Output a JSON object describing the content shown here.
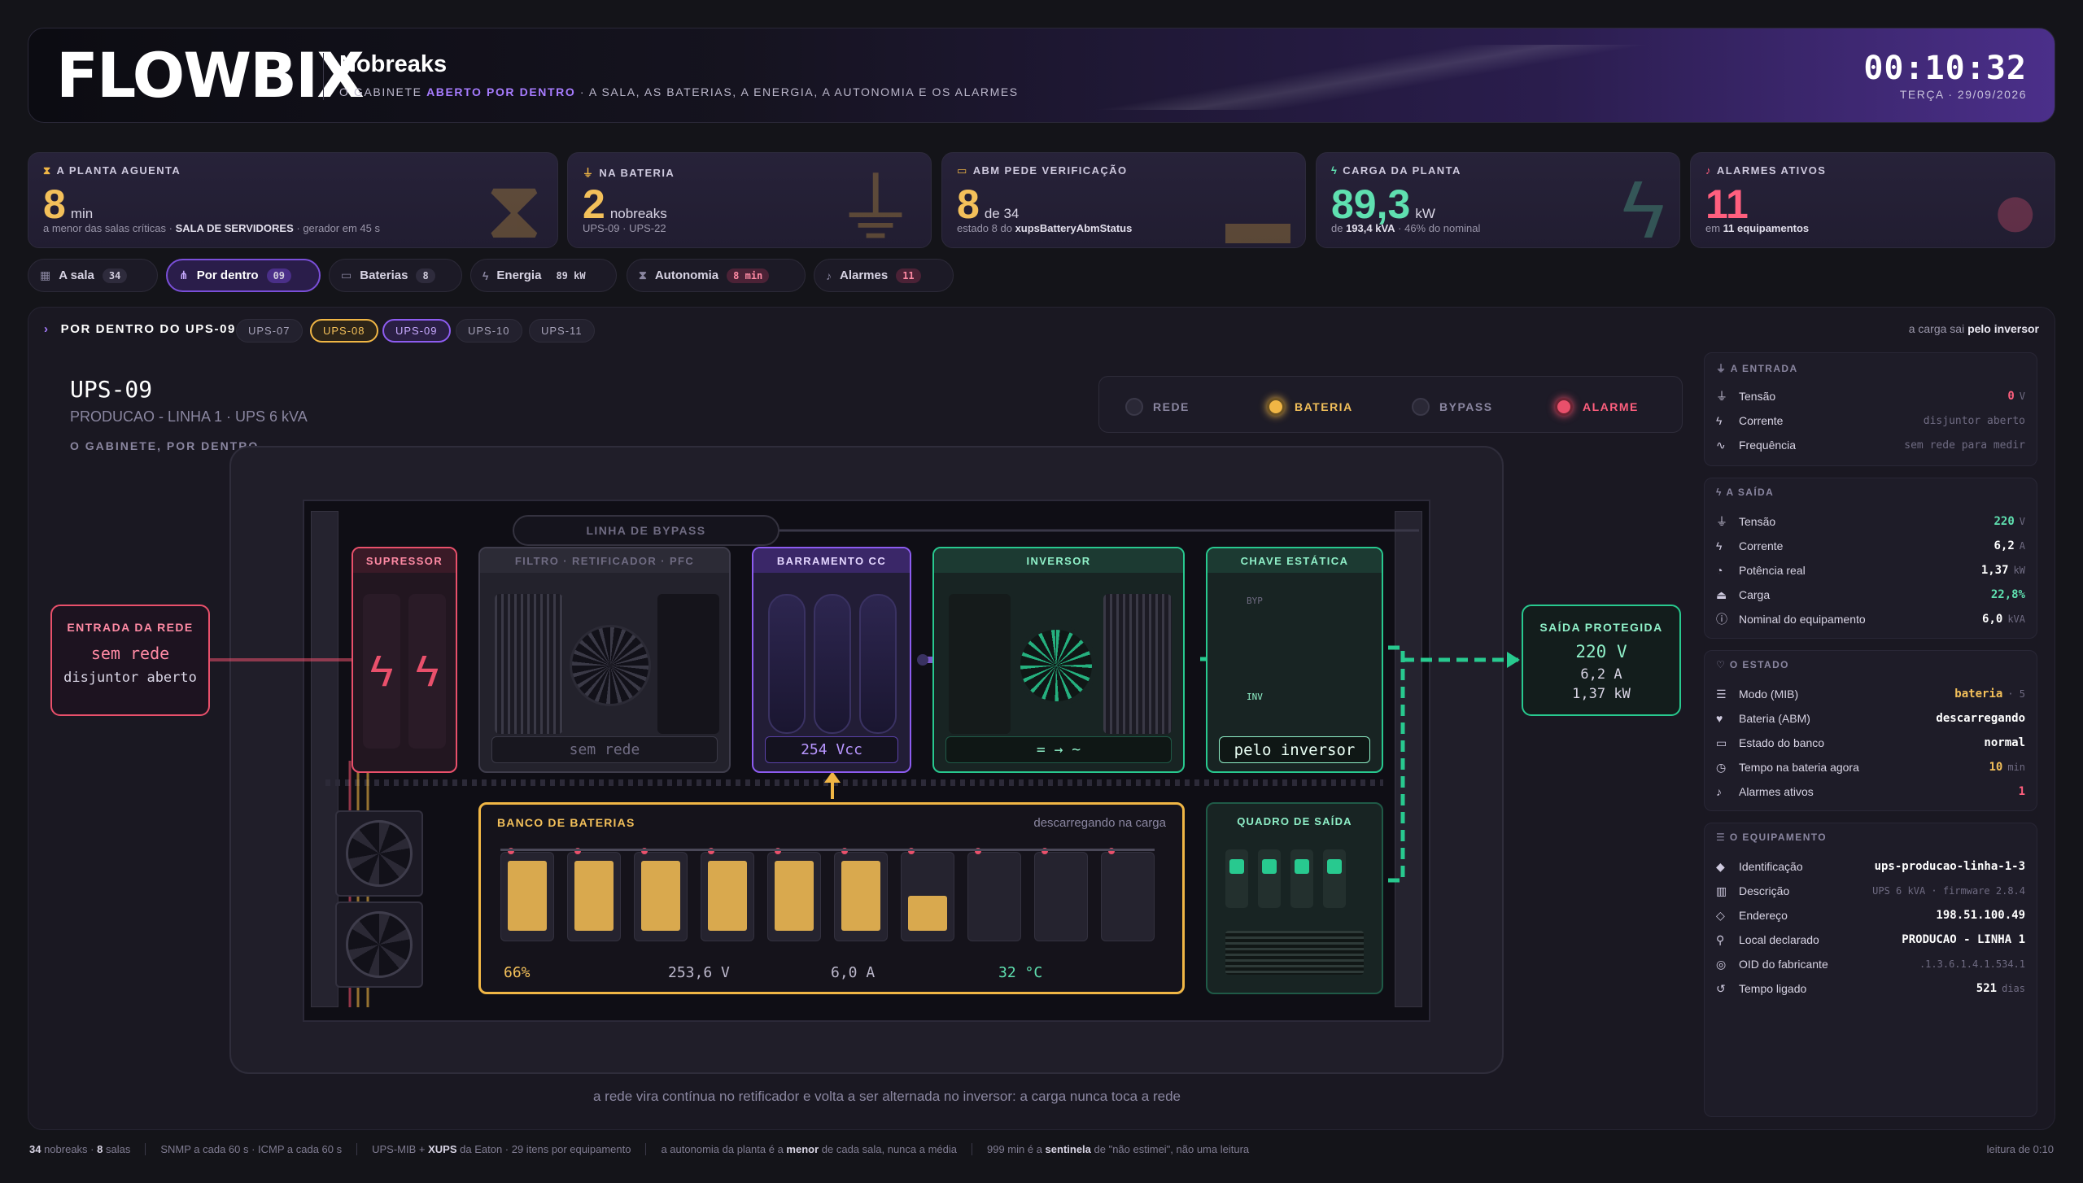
{
  "header": {
    "logo": "FLOWBIX",
    "title": "Nobreaks",
    "subtitle_pre": "O GABINETE ",
    "subtitle_hl": "ABERTO POR DENTRO",
    "subtitle_post": " · A SALA, AS BATERIAS, A ENERGIA, A AUTONOMIA E OS ALARMES",
    "clock": "00:10:32",
    "date": "TERÇA · 29/09/2026"
  },
  "kpis": [
    {
      "label": "A PLANTA AGUENTA",
      "value": "8",
      "unit": "min",
      "sub_pre": "a menor das salas críticas · ",
      "sub_b": "SALA DE SERVIDORES",
      "sub_post": " · gerador em 45 s",
      "color": "#f3c05a",
      "icon": "hourglass-icon"
    },
    {
      "label": "NA BATERIA",
      "value": "2",
      "unit": "nobreaks",
      "sub_pre": "UPS-09 · UPS-22",
      "sub_b": "",
      "sub_post": "",
      "color": "#f3c05a",
      "icon": "plug-icon"
    },
    {
      "label": "ABM PEDE VERIFICAÇÃO",
      "value": "8",
      "unit": "de 34",
      "sub_pre": "estado 8 do ",
      "sub_b": "xupsBatteryAbmStatus",
      "sub_post": "",
      "color": "#f3c05a",
      "icon": "battery-icon"
    },
    {
      "label": "CARGA DA PLANTA",
      "value": "89,3",
      "unit": "kW",
      "sub_pre": "de ",
      "sub_b": "193,4 kVA",
      "sub_post": " · 46% do nominal",
      "color": "#5fe0b0",
      "icon": "bolt-icon"
    },
    {
      "label": "ALARMES ATIVOS",
      "value": "11",
      "unit": "",
      "sub_pre": "em ",
      "sub_b": "11 equipamentos",
      "sub_post": "",
      "color": "#ff5f7e",
      "icon": "bell-icon"
    }
  ],
  "tabs": [
    {
      "label": "A sala",
      "count": "34"
    },
    {
      "label": "Por dentro",
      "count": "09"
    },
    {
      "label": "Baterias",
      "count": "8"
    },
    {
      "label": "Energia",
      "count": "89 kW"
    },
    {
      "label": "Autonomia",
      "count": "8 min"
    },
    {
      "label": "Alarmes",
      "count": "11"
    }
  ],
  "panel": {
    "title": "POR DENTRO DO UPS-09",
    "chips": [
      "UPS-07",
      "UPS-08",
      "UPS-09",
      "UPS-10",
      "UPS-11"
    ],
    "right_pre": "a carga sai ",
    "right_b": "pelo inversor",
    "caption": "a rede vira contínua no retificador e volta a ser alternada no inversor: a carga nunca toca a rede"
  },
  "ups": {
    "name": "UPS-09",
    "desc": "PRODUCAO - LINHA 1 · UPS 6 kVA",
    "cabinet": "O GABINETE, POR DENTRO"
  },
  "legend": [
    {
      "label": "REDE",
      "color": "#3a3848"
    },
    {
      "label": "BATERIA",
      "color": "#f0b645"
    },
    {
      "label": "BYPASS",
      "color": "#3a3848"
    },
    {
      "label": "ALARME",
      "color": "#e9506b"
    }
  ],
  "diagram": {
    "entrada_title": "ENTRADA DA REDE",
    "entrada_l1": "sem rede",
    "entrada_l2": "disjuntor aberto",
    "bypass": "LINHA DE BYPASS",
    "supressor": "SUPRESSOR",
    "filtro": "FILTRO · RETIFICADOR · PFC",
    "filtro_disp": "sem rede",
    "barramento": "BARRAMENTO CC",
    "barramento_disp": "254 Vcc",
    "inversor": "INVERSOR",
    "inversor_disp": "= → ~",
    "chave": "CHAVE ESTÁTICA",
    "chave_disp": "pelo inversor",
    "byp": "BYP",
    "inv": "INV",
    "banco_title": "BANCO DE BATERIAS",
    "banco_state": "descarregando na carga",
    "banco_pct": "66%",
    "banco_v": "253,6 V",
    "banco_a": "6,0 A",
    "banco_t": "32 °C",
    "cells": [
      1,
      1,
      1,
      1,
      1,
      1,
      0.5,
      0,
      0,
      0
    ],
    "quadro": "QUADRO DE SAÍDA",
    "saida_title": "SAÍDA PROTEGIDA",
    "saida_v": "220 V",
    "saida_a": "6,2 A",
    "saida_kw": "1,37 kW"
  },
  "sidebar": {
    "entrada": {
      "title": "A ENTRADA",
      "rows": [
        {
          "label": "Tensão",
          "value": "0",
          "unit": "V",
          "color": "#ff5f7e",
          "icon": "plug-icon"
        },
        {
          "label": "Corrente",
          "value": "disjuntor aberto",
          "unit": "",
          "dim": true,
          "icon": "bolt-icon"
        },
        {
          "label": "Frequência",
          "value": "sem rede para medir",
          "unit": "",
          "dim": true,
          "icon": "wave-icon"
        }
      ]
    },
    "saida": {
      "title": "A SAÍDA",
      "rows": [
        {
          "label": "Tensão",
          "value": "220",
          "unit": "V",
          "color": "#5fe0b0",
          "icon": "plug-icon"
        },
        {
          "label": "Corrente",
          "value": "6,2",
          "unit": "A",
          "icon": "bolt-icon"
        },
        {
          "label": "Potência real",
          "value": "1,37",
          "unit": "kW",
          "icon": "gauge-icon"
        },
        {
          "label": "Carga",
          "value": "22,8%",
          "unit": "",
          "color": "#5fe0b0",
          "icon": "weight-icon"
        },
        {
          "label": "Nominal do equipamento",
          "value": "6,0",
          "unit": "kVA",
          "icon": "info-icon"
        }
      ]
    },
    "estado": {
      "title": "O ESTADO",
      "rows": [
        {
          "label": "Modo (MIB)",
          "value": "bateria",
          "unit": "· 5",
          "color": "#f3c05a",
          "icon": "list-icon"
        },
        {
          "label": "Bateria (ABM)",
          "value": "descarregando",
          "unit": "",
          "icon": "heart-icon"
        },
        {
          "label": "Estado do banco",
          "value": "normal",
          "unit": "",
          "icon": "battery-icon"
        },
        {
          "label": "Tempo na bateria agora",
          "value": "10",
          "unit": "min",
          "color": "#f3c05a",
          "icon": "clock-icon"
        },
        {
          "label": "Alarmes ativos",
          "value": "1",
          "unit": "",
          "color": "#ff5f7e",
          "icon": "bell-icon"
        }
      ]
    },
    "equip": {
      "title": "O EQUIPAMENTO",
      "rows": [
        {
          "label": "Identificação",
          "value": "ups-producao-linha-1-3",
          "unit": "",
          "icon": "tag-icon"
        },
        {
          "label": "Descrição",
          "value": "UPS 6 kVA · firmware 2.8.4",
          "unit": "",
          "dim": true,
          "icon": "barcode-icon"
        },
        {
          "label": "Endereço",
          "value": "198.51.100.49",
          "unit": "",
          "icon": "diamond-icon"
        },
        {
          "label": "Local declarado",
          "value": "PRODUCAO - LINHA 1",
          "unit": "",
          "icon": "pin-icon"
        },
        {
          "label": "OID do fabricante",
          "value": ".1.3.6.1.4.1.534.1",
          "unit": "",
          "dim": true,
          "icon": "fingerprint-icon"
        },
        {
          "label": "Tempo ligado",
          "value": "521",
          "unit": "dias",
          "icon": "history-icon"
        }
      ]
    }
  },
  "footer": {
    "f1_b": "34",
    "f1": " nobreaks · ",
    "f1_b2": "8",
    "f1_2": " salas",
    "f2": "SNMP a cada 60 s · ICMP a cada 60 s",
    "f3_pre": "UPS-MIB + ",
    "f3_b": "XUPS",
    "f3_post": " da Eaton · 29 itens por equipamento",
    "f4_pre": "a autonomia da planta é a ",
    "f4_b": "menor",
    "f4_post": " de cada sala, nunca a média",
    "f5_pre": "999 min é a ",
    "f5_b": "sentinela",
    "f5_post": " de \"não estimei\", não uma leitura",
    "right": "leitura de 0:10"
  }
}
